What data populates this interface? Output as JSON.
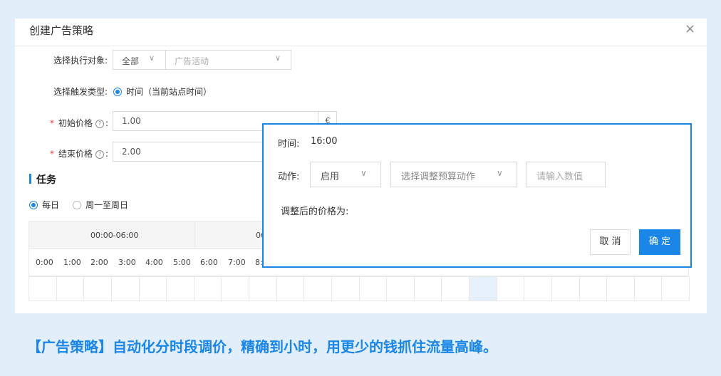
{
  "dialog": {
    "title": "创建广告策略",
    "close_glyph": "×"
  },
  "form": {
    "target": {
      "label": "选择执行对象:",
      "scope_value": "全部",
      "campaign_placeholder": "广告活动"
    },
    "trigger": {
      "label": "选择触发类型:",
      "option": "时间（当前站点时间）"
    },
    "initial_price": {
      "required": "*",
      "label": "初始价格",
      "colon": ":",
      "value": "1.00",
      "currency": "€"
    },
    "end_price": {
      "required": "*",
      "label": "结束价格",
      "colon": ":",
      "value": "2.00"
    }
  },
  "task": {
    "title": "任务",
    "radios": [
      {
        "label": "每日",
        "selected": true
      },
      {
        "label": "周一至周日",
        "selected": false
      }
    ],
    "ranges": [
      "00:00-06:00",
      "06"
    ],
    "hours": [
      "0:00",
      "1:00",
      "2:00",
      "3:00",
      "4:00",
      "5:00",
      "6:00",
      "7:00",
      "8:"
    ]
  },
  "popup": {
    "time_label": "时间:",
    "time_value": "16:00",
    "action_label": "动作:",
    "action_value": "启用",
    "adjust_placeholder": "选择调整预算动作",
    "number_placeholder": "请输入数值",
    "adjusted_label": "调整后的价格为:",
    "cancel_label": "取 消",
    "ok_label": "确 定"
  },
  "caption": "【广告策略】自动化分时段调价，精确到小时，用更少的钱抓住流量高峰。",
  "colors": {
    "accent": "#1a86e8",
    "background": "#e2eef9",
    "required": "#e4393c",
    "selected_cell": "#e6f1fc"
  },
  "icons": {
    "chevron": "chevron-down-icon",
    "help": "question-circle-icon",
    "close": "close-icon"
  }
}
